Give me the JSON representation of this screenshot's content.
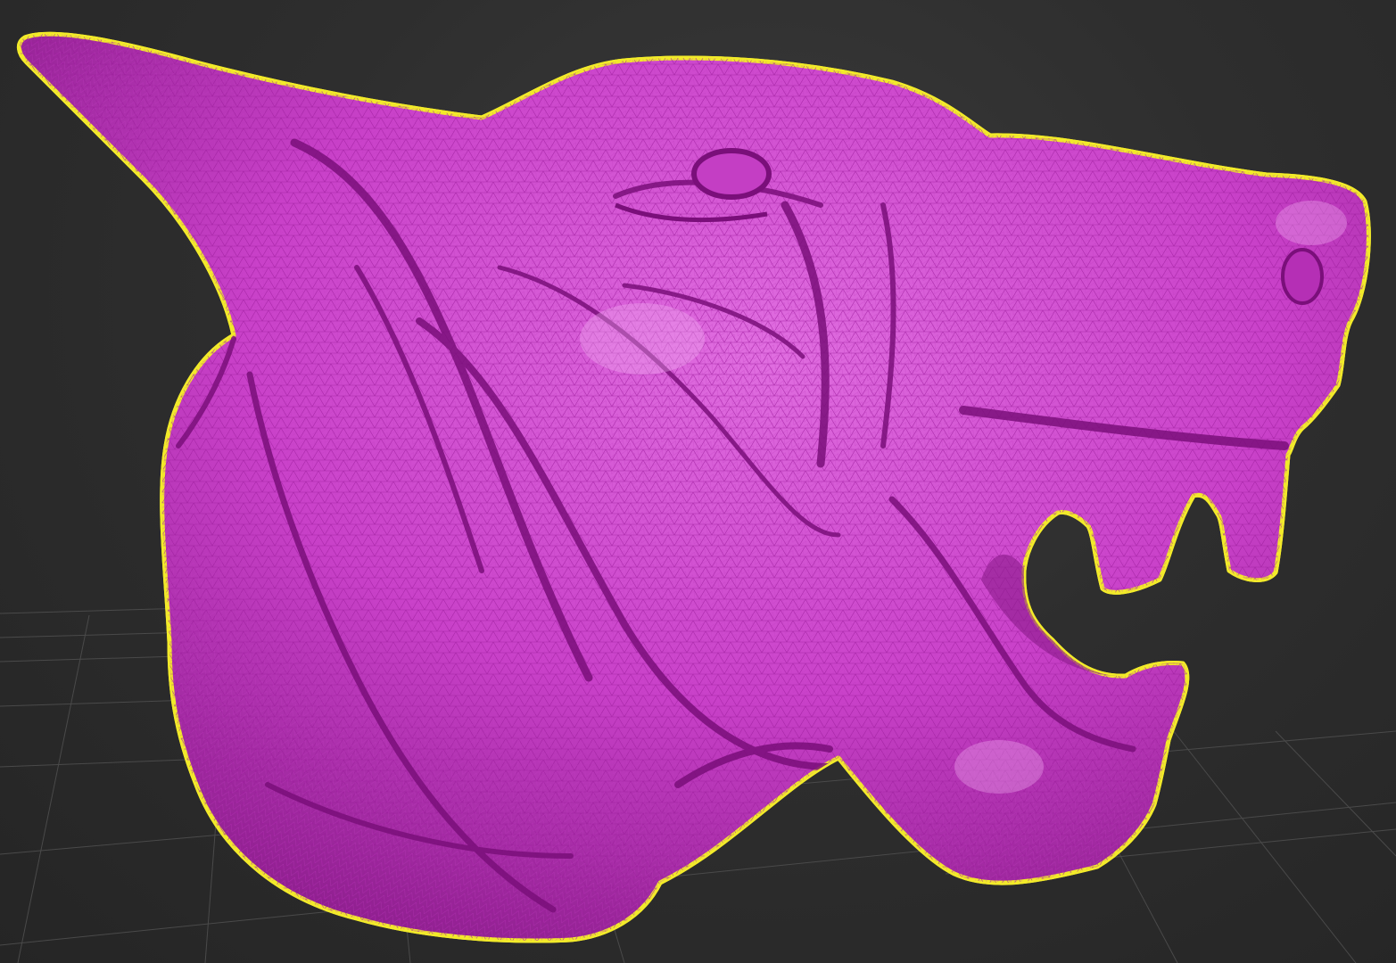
{
  "viewport": {
    "background_color": "#2e2e2e",
    "grid_color": "#4a4a4a",
    "selection_outline_color": "#f2ea2a",
    "wireframe_color": "#b020b0",
    "mesh_fill_color": "#d14bd1",
    "object": {
      "name": "creature-head-mesh",
      "icon": "none",
      "selected": true,
      "display_mode": "shaded-wireframe"
    }
  }
}
